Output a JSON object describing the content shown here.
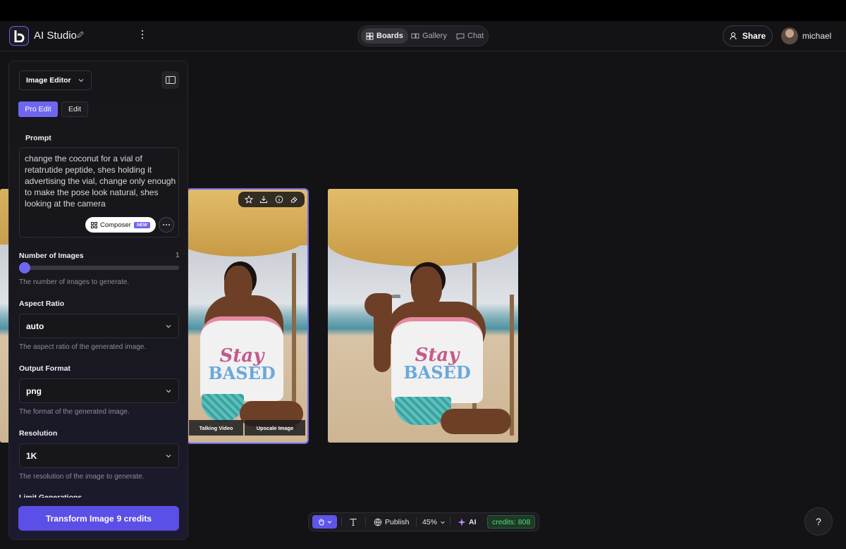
{
  "header": {
    "app_title": "AI Studio",
    "nav": [
      {
        "label": "Boards",
        "icon": "boards-icon",
        "active": true
      },
      {
        "label": "Gallery",
        "icon": "gallery-icon",
        "active": false
      },
      {
        "label": "Chat",
        "icon": "chat-icon",
        "active": false
      }
    ],
    "share_label": "Share",
    "username": "michael"
  },
  "panel": {
    "mode": "Image Editor",
    "tabs": [
      {
        "label": "Pro Edit",
        "active": true
      },
      {
        "label": "Edit",
        "active": false
      }
    ],
    "prompt_label": "Prompt",
    "prompt_text": "change the coconut for a vial of retatrutide peptide, shes holding it advertising the vial, change only enough to make the pose look natural, shes looking at the camera",
    "composer_label": "Composer",
    "composer_badge": "NEW",
    "num_images": {
      "label": "Number of Images",
      "value": "1",
      "help": "The number of images to generate."
    },
    "aspect_ratio": {
      "label": "Aspect Ratio",
      "value": "auto",
      "help": "The aspect ratio of the generated image."
    },
    "output_format": {
      "label": "Output Format",
      "value": "png",
      "help": "The format of the generated image."
    },
    "resolution": {
      "label": "Resolution",
      "value": "1K",
      "help": "The resolution of the image to generate."
    },
    "limit_label": "Limit Generations",
    "transform_label": "Transform Image",
    "transform_credits": "9 credits"
  },
  "canvas": {
    "shirt_line1": "Stay",
    "shirt_line2": "BASED",
    "selected_actions": [
      "Talking Video",
      "Upscale Image"
    ]
  },
  "bottom_bar": {
    "publish_label": "Publish",
    "zoom": "45%",
    "ai_label": "AI",
    "credits": "credits: 808"
  },
  "colors": {
    "accent": "#6f66f0",
    "credits_green": "#57d97b"
  }
}
